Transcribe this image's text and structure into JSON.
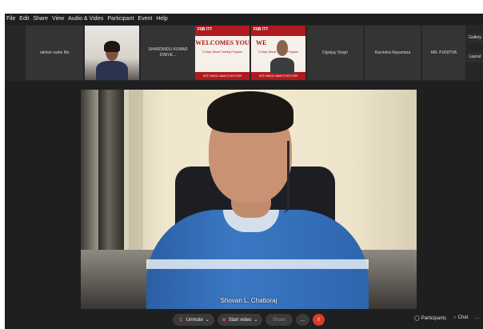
{
  "menubar": {
    "items": [
      "File",
      "Edit",
      "Share",
      "View",
      "Audio & Video",
      "Participant",
      "Event",
      "Help"
    ]
  },
  "strip": {
    "tiles": [
      {
        "name": "rakhee wahe Ms",
        "kind": "name"
      },
      {
        "name": "",
        "kind": "camera"
      },
      {
        "name": "SHARDINDU KUMAR DWIVE...",
        "kind": "name"
      },
      {
        "kind": "slide",
        "logo": "FIIB ITT",
        "welcome": "WELCOMES YOU",
        "sub": "5 Days Virtual Training Program",
        "footer": "ESTI MOOC ANALYTICS FOR MANAGEMENT"
      },
      {
        "kind": "slide-camera",
        "logo": "FIIB ITT",
        "welcome": "WE",
        "sub": "5 Days Virtual Training Program",
        "footer": "ESTI MOOC ANALYTICS FOR MANAGEMENT"
      },
      {
        "name": "Digvijay Singh",
        "kind": "name"
      },
      {
        "name": "Ravindra Nayantara",
        "kind": "name"
      },
      {
        "name": "MR. PUNITHA",
        "kind": "name"
      }
    ],
    "side_buttons": {
      "gallery": "Gallery",
      "layout": "Layout"
    }
  },
  "main_video": {
    "speaker": "Shovan L. Chattoraj"
  },
  "toolbar": {
    "unmute": "Unmute",
    "start_video": "Start video",
    "share": "Share",
    "more": "...",
    "end": "X",
    "participants": "Participants",
    "chat": "Chat",
    "overflow": "..."
  },
  "colors": {
    "accent_red": "#d93a2c",
    "slide_red": "#b0191e",
    "background": "#1f1f1f"
  }
}
